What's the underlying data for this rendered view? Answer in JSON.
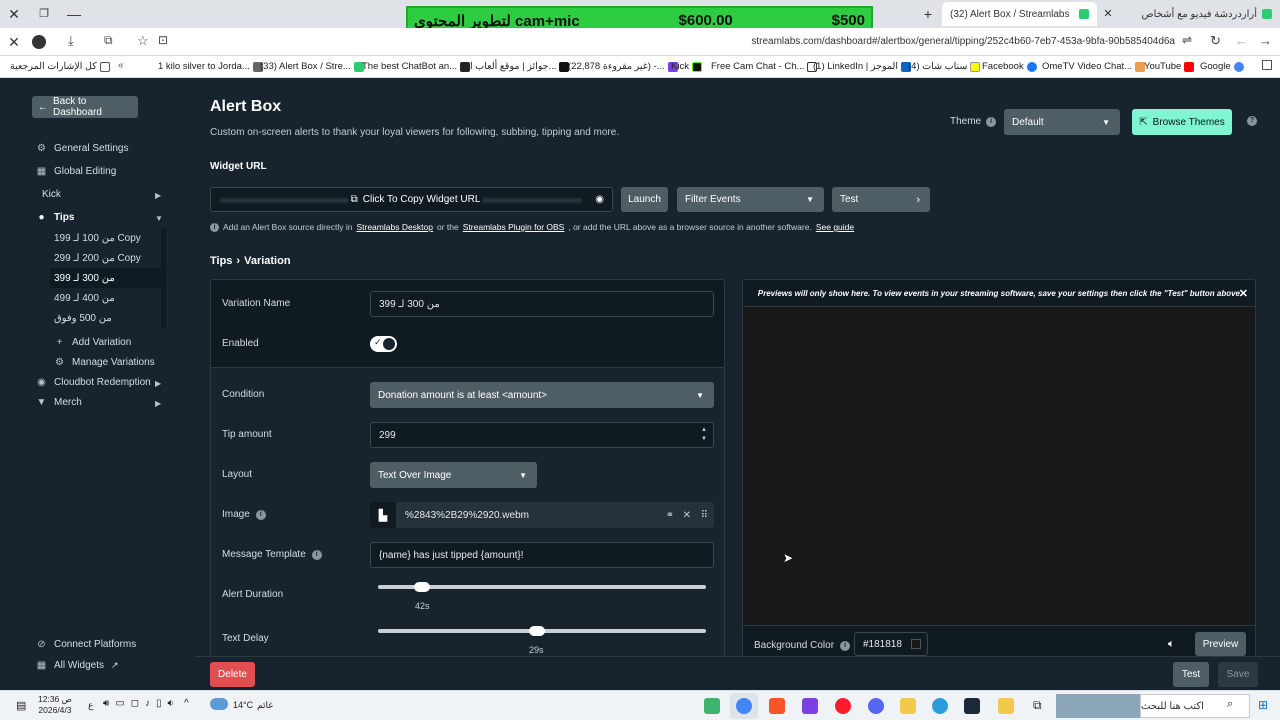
{
  "browser": {
    "tabs": [
      {
        "label": "أراردردشة فيديو مع أشخاص"
      },
      {
        "label": "(32) Alert Box / Streamlabs"
      }
    ],
    "address": "streamlabs.com/dashboard#/alertbox/general/tipping/252c4b60-7eb7-453a-9bfa-90b585404d6a",
    "bookmarks": [
      "كل الإشارات المرجعية",
      "1 kilo silver to Jorda...",
      "(33) Alert Box / Stre...",
      "The best ChatBot an...",
      "جوائز | موقع ألعاب ا...",
      "(22,878 غير مقروءة) -...",
      "Kick",
      "Free Cam Chat - Ch...",
      "(1) LinkedIn | الموجز",
      "(4) سناب شات",
      "Facebook",
      "OmeTV Video Chat...",
      "YouTube",
      "Google"
    ]
  },
  "overlay": {
    "left": "cam+mic لتطوير المحتوى",
    "middle": "$600.00",
    "right": "$500"
  },
  "sidebar": {
    "back_label": "Back to Dashboard",
    "items": [
      {
        "label": "General Settings"
      },
      {
        "label": "Global Editing"
      },
      {
        "label": "Kick"
      },
      {
        "label": "Tips"
      }
    ],
    "variations": [
      "من 100 لـ 199 Copy",
      "من 200 لـ 299 Copy",
      "من 300 لـ 399",
      "من 400 لـ 499",
      "من 500 وفوق"
    ],
    "add_variation": "Add Variation",
    "manage_variations": "Manage Variations",
    "cloudbot": "Cloudbot Redemption",
    "merch": "Merch",
    "connect_platforms": "Connect Platforms",
    "all_widgets": "All Widgets"
  },
  "header": {
    "title": "Alert Box",
    "subtitle": "Custom on-screen alerts to thank your loyal viewers for following, subbing, tipping and more.",
    "theme_label": "Theme",
    "theme_value": "Default",
    "browse_themes": "Browse Themes"
  },
  "widget": {
    "url_label": "Widget URL",
    "copy_label": "Click To Copy Widget URL",
    "launch": "Launch",
    "filter_events": "Filter Events",
    "test": "Test",
    "note_prefix": "Add an Alert Box source directly in",
    "note_link1": "Streamlabs Desktop",
    "note_or": "or the",
    "note_link2": "Streamlabs Plugin for OBS",
    "note_suffix": ", or add the URL above as a browser source in another software.",
    "note_link3": "See guide"
  },
  "breadcrumb": {
    "parent": "Tips",
    "child": "Variation"
  },
  "form": {
    "variation_name_label": "Variation Name",
    "variation_name_value": "من 300 لـ 399",
    "enabled_label": "Enabled",
    "condition_label": "Condition",
    "condition_value": "Donation amount is at least <amount>",
    "tip_amount_label": "Tip amount",
    "tip_amount_value": "299",
    "layout_label": "Layout",
    "layout_value": "Text Over Image",
    "image_label": "Image",
    "image_value": "%2843%2B29%2920.webm",
    "message_template_label": "Message Template",
    "message_template_value": "{name} has just tipped {amount}!",
    "alert_duration_label": "Alert Duration",
    "alert_duration_value": "42s",
    "text_delay_label": "Text Delay",
    "text_delay_value": "29s"
  },
  "preview": {
    "note": "Previews will only show here. To view events in your streaming software, save your settings then click the \"Test\" button above.",
    "bg_color_label": "Background Color",
    "bg_color_value": "#181818",
    "preview_btn": "Preview"
  },
  "actions": {
    "delete": "Delete",
    "test": "Test",
    "save": "Save"
  },
  "taskbar": {
    "time": "12:36 ص",
    "date": "2026/4/3",
    "weather": "14°C",
    "weather_text": "غائم",
    "lang": "ع",
    "search_placeholder": "اكتب هنا للبحث"
  },
  "colors": {
    "accent_teal": "#80f5d2",
    "delete_red": "#e04f4f",
    "bg": "#17242d"
  }
}
